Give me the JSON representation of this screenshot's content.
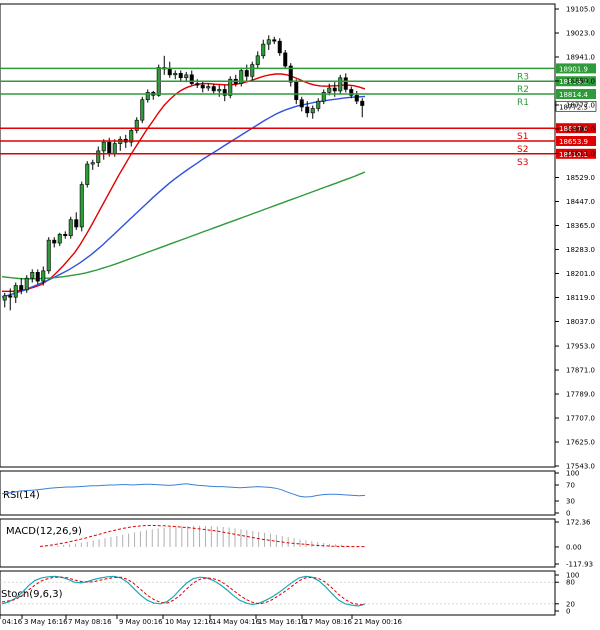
{
  "chart_data": {
    "type": "candlestick",
    "price_axis": {
      "ticks": [
        "19105.0",
        "19023.0",
        "18941.0",
        "18859.0",
        "18777.0",
        "18695.0",
        "18611.0",
        "18529.0",
        "18447.0",
        "18365.0",
        "18283.0",
        "18201.0",
        "18119.0",
        "18037.0",
        "17953.0",
        "17871.0",
        "17789.0",
        "17707.0",
        "17625.0",
        "17543.0"
      ],
      "ylim": [
        17543.0,
        19105.0
      ]
    },
    "time_axis": {
      "ticks": [
        "04:16",
        "3 May 16:16",
        "7 May 08:16",
        "9 May 00:16",
        "10 May 12:16",
        "14 May 04:16",
        "15 May 16:16",
        "17 May 08:16",
        "21 May 00:16"
      ]
    },
    "candles": [
      {
        "o": 18110,
        "h": 18135,
        "l": 18085,
        "c": 18125
      },
      {
        "o": 18125,
        "h": 18150,
        "l": 18075,
        "c": 18120
      },
      {
        "o": 18120,
        "h": 18170,
        "l": 18100,
        "c": 18160
      },
      {
        "o": 18160,
        "h": 18185,
        "l": 18130,
        "c": 18145
      },
      {
        "o": 18145,
        "h": 18195,
        "l": 18135,
        "c": 18185
      },
      {
        "o": 18185,
        "h": 18215,
        "l": 18170,
        "c": 18205
      },
      {
        "o": 18205,
        "h": 18215,
        "l": 18165,
        "c": 18175
      },
      {
        "o": 18175,
        "h": 18225,
        "l": 18160,
        "c": 18210
      },
      {
        "o": 18210,
        "h": 18325,
        "l": 18200,
        "c": 18315
      },
      {
        "o": 18315,
        "h": 18325,
        "l": 18290,
        "c": 18305
      },
      {
        "o": 18305,
        "h": 18340,
        "l": 18295,
        "c": 18335
      },
      {
        "o": 18335,
        "h": 18345,
        "l": 18320,
        "c": 18330
      },
      {
        "o": 18330,
        "h": 18395,
        "l": 18320,
        "c": 18385
      },
      {
        "o": 18385,
        "h": 18410,
        "l": 18350,
        "c": 18360
      },
      {
        "o": 18360,
        "h": 18515,
        "l": 18345,
        "c": 18505
      },
      {
        "o": 18505,
        "h": 18585,
        "l": 18495,
        "c": 18575
      },
      {
        "o": 18575,
        "h": 18590,
        "l": 18555,
        "c": 18580
      },
      {
        "o": 18580,
        "h": 18635,
        "l": 18565,
        "c": 18620
      },
      {
        "o": 18620,
        "h": 18660,
        "l": 18590,
        "c": 18650
      },
      {
        "o": 18650,
        "h": 18665,
        "l": 18600,
        "c": 18610
      },
      {
        "o": 18610,
        "h": 18660,
        "l": 18600,
        "c": 18645
      },
      {
        "o": 18645,
        "h": 18670,
        "l": 18620,
        "c": 18660
      },
      {
        "o": 18660,
        "h": 18675,
        "l": 18630,
        "c": 18650
      },
      {
        "o": 18650,
        "h": 18700,
        "l": 18635,
        "c": 18690
      },
      {
        "o": 18690,
        "h": 18735,
        "l": 18680,
        "c": 18725
      },
      {
        "o": 18725,
        "h": 18805,
        "l": 18715,
        "c": 18795
      },
      {
        "o": 18795,
        "h": 18830,
        "l": 18785,
        "c": 18820
      },
      {
        "o": 18820,
        "h": 18825,
        "l": 18795,
        "c": 18810
      },
      {
        "o": 18810,
        "h": 18915,
        "l": 18805,
        "c": 18905
      },
      {
        "o": 18905,
        "h": 18945,
        "l": 18880,
        "c": 18900
      },
      {
        "o": 18900,
        "h": 18925,
        "l": 18870,
        "c": 18880
      },
      {
        "o": 18880,
        "h": 18895,
        "l": 18865,
        "c": 18885
      },
      {
        "o": 18885,
        "h": 18895,
        "l": 18860,
        "c": 18870
      },
      {
        "o": 18870,
        "h": 18890,
        "l": 18855,
        "c": 18880
      },
      {
        "o": 18880,
        "h": 18895,
        "l": 18845,
        "c": 18850
      },
      {
        "o": 18850,
        "h": 18865,
        "l": 18835,
        "c": 18845
      },
      {
        "o": 18845,
        "h": 18860,
        "l": 18820,
        "c": 18835
      },
      {
        "o": 18835,
        "h": 18850,
        "l": 18825,
        "c": 18840
      },
      {
        "o": 18840,
        "h": 18850,
        "l": 18815,
        "c": 18825
      },
      {
        "o": 18825,
        "h": 18845,
        "l": 18805,
        "c": 18830
      },
      {
        "o": 18830,
        "h": 18845,
        "l": 18790,
        "c": 18810
      },
      {
        "o": 18810,
        "h": 18875,
        "l": 18800,
        "c": 18865
      },
      {
        "o": 18865,
        "h": 18880,
        "l": 18840,
        "c": 18850
      },
      {
        "o": 18850,
        "h": 18905,
        "l": 18840,
        "c": 18895
      },
      {
        "o": 18895,
        "h": 18915,
        "l": 18860,
        "c": 18875
      },
      {
        "o": 18875,
        "h": 18925,
        "l": 18860,
        "c": 18915
      },
      {
        "o": 18915,
        "h": 18960,
        "l": 18900,
        "c": 18945
      },
      {
        "o": 18945,
        "h": 19000,
        "l": 18935,
        "c": 18985
      },
      {
        "o": 18985,
        "h": 19015,
        "l": 18965,
        "c": 19000
      },
      {
        "o": 19000,
        "h": 19010,
        "l": 18985,
        "c": 18995
      },
      {
        "o": 18995,
        "h": 19005,
        "l": 18945,
        "c": 18955
      },
      {
        "o": 18955,
        "h": 18965,
        "l": 18900,
        "c": 18910
      },
      {
        "o": 18910,
        "h": 18920,
        "l": 18840,
        "c": 18855
      },
      {
        "o": 18855,
        "h": 18865,
        "l": 18780,
        "c": 18795
      },
      {
        "o": 18795,
        "h": 18805,
        "l": 18755,
        "c": 18770
      },
      {
        "o": 18770,
        "h": 18790,
        "l": 18735,
        "c": 18750
      },
      {
        "o": 18750,
        "h": 18775,
        "l": 18730,
        "c": 18765
      },
      {
        "o": 18765,
        "h": 18800,
        "l": 18755,
        "c": 18790
      },
      {
        "o": 18790,
        "h": 18830,
        "l": 18780,
        "c": 18820
      },
      {
        "o": 18820,
        "h": 18850,
        "l": 18810,
        "c": 18835
      },
      {
        "o": 18835,
        "h": 18855,
        "l": 18805,
        "c": 18825
      },
      {
        "o": 18825,
        "h": 18880,
        "l": 18815,
        "c": 18870
      },
      {
        "o": 18870,
        "h": 18885,
        "l": 18820,
        "c": 18830
      },
      {
        "o": 18830,
        "h": 18840,
        "l": 18800,
        "c": 18810
      },
      {
        "o": 18810,
        "h": 18825,
        "l": 18780,
        "c": 18790
      },
      {
        "o": 18790,
        "h": 18800,
        "l": 18735,
        "c": 18775
      }
    ],
    "moving_averages": [
      {
        "color": "#e00000",
        "values": [
          18140,
          18140,
          18140,
          18142,
          18145,
          18150,
          18156,
          18163,
          18175,
          18190,
          18208,
          18228,
          18250,
          18272,
          18300,
          18332,
          18365,
          18400,
          18435,
          18470,
          18505,
          18540,
          18572,
          18605,
          18635,
          18665,
          18695,
          18722,
          18750,
          18775,
          18795,
          18812,
          18826,
          18836,
          18843,
          18848,
          18850,
          18850,
          18848,
          18847,
          18846,
          18846,
          18848,
          18852,
          18857,
          18863,
          18870,
          18876,
          18880,
          18883,
          18883,
          18880,
          18874,
          18866,
          18858,
          18850,
          18845,
          18842,
          18841,
          18842,
          18843,
          18845,
          18845,
          18843,
          18838,
          18832
        ]
      },
      {
        "color": "#3050e0",
        "values": [
          18120,
          18126,
          18132,
          18138,
          18144,
          18152,
          18160,
          18168,
          18176,
          18185,
          18194,
          18204,
          18214,
          18226,
          18238,
          18252,
          18266,
          18282,
          18298,
          18316,
          18334,
          18352,
          18370,
          18388,
          18406,
          18424,
          18442,
          18460,
          18477,
          18494,
          18510,
          18525,
          18539,
          18553,
          18566,
          18579,
          18592,
          18604,
          18616,
          18628,
          18640,
          18652,
          18664,
          18676,
          18688,
          18700,
          18712,
          18724,
          18735,
          18745,
          18754,
          18762,
          18768,
          18774,
          18778,
          18782,
          18786,
          18789,
          18792,
          18795,
          18797,
          18800,
          18802,
          18804,
          18805,
          18806
        ]
      },
      {
        "color": "#2e9a3a",
        "values": [
          18190,
          18188,
          18186,
          18184,
          18183,
          18183,
          18183,
          18184,
          18185,
          18186,
          18188,
          18190,
          18193,
          18196,
          18199,
          18203,
          18208,
          18213,
          18219,
          18225,
          18231,
          18238,
          18245,
          18252,
          18259,
          18266,
          18273,
          18280,
          18287,
          18294,
          18301,
          18308,
          18315,
          18322,
          18329,
          18336,
          18343,
          18350,
          18357,
          18364,
          18371,
          18378,
          18385,
          18392,
          18399,
          18406,
          18413,
          18420,
          18427,
          18434,
          18441,
          18448,
          18455,
          18462,
          18469,
          18476,
          18483,
          18490,
          18497,
          18504,
          18511,
          18518,
          18525,
          18532,
          18540,
          18548
        ]
      }
    ],
    "levels": [
      {
        "name": "R3",
        "value": 18901.9,
        "label": "18901.9",
        "color": "#2e9a3a"
      },
      {
        "name": "R2",
        "value": 18858.1,
        "label": "18858.1",
        "color": "#2e9a3a"
      },
      {
        "name": "R1",
        "value": 18814.4,
        "label": "18814.4",
        "color": "#2e9a3a"
      },
      {
        "name": "S1",
        "value": 18697.6,
        "label": "18697.6",
        "color": "#e00000"
      },
      {
        "name": "S2",
        "value": 18653.9,
        "label": "18653.9",
        "color": "#e00000"
      },
      {
        "name": "S3",
        "value": 18610.1,
        "label": "18610.1",
        "color": "#e00000"
      }
    ],
    "current_price": {
      "value": 18772.5,
      "label": "18772.5"
    },
    "rsi": {
      "title": "RSI(14)",
      "ticks": [
        "100",
        "70",
        "30",
        "0"
      ],
      "ylim": [
        0,
        100
      ],
      "values": [
        48,
        50,
        52,
        55,
        56,
        57,
        58,
        60,
        62,
        63,
        64,
        65,
        65,
        66,
        67,
        68,
        68,
        69,
        70,
        70,
        71,
        71,
        70,
        71,
        72,
        72,
        71,
        70,
        69,
        70,
        72,
        73,
        71,
        69,
        68,
        67,
        66,
        66,
        65,
        64,
        63,
        64,
        65,
        66,
        65,
        64,
        62,
        58,
        52,
        47,
        42,
        40,
        41,
        44,
        46,
        47,
        47,
        46,
        45,
        44,
        43,
        44
      ]
    },
    "macd": {
      "title": "MACD(12,26,9)",
      "ticks": [
        "172.36",
        "0.00",
        "-117.93"
      ],
      "ylim": [
        -117.93,
        172.36
      ],
      "histogram": [
        2,
        4,
        6,
        10,
        14,
        18,
        24,
        30,
        36,
        44,
        52,
        60,
        68,
        76,
        84,
        92,
        100,
        108,
        116,
        122,
        128,
        132,
        136,
        140,
        142,
        144,
        145,
        146,
        145,
        144,
        142,
        138,
        134,
        128,
        122,
        116,
        110,
        104,
        98,
        92,
        84,
        76,
        68,
        60,
        52,
        46,
        40,
        34,
        28,
        22,
        18,
        14,
        10,
        6,
        4,
        2
      ],
      "signal": [
        4,
        8,
        14,
        22,
        30,
        40,
        50,
        60,
        72,
        84,
        96,
        108,
        118,
        128,
        136,
        142,
        146,
        148,
        148,
        147,
        145,
        142,
        138,
        134,
        130,
        125,
        120,
        114,
        108,
        100,
        92,
        84,
        76,
        68,
        60,
        52,
        46,
        40,
        34,
        28,
        24,
        20,
        16,
        12,
        9,
        7,
        5,
        4,
        3,
        2,
        2,
        2
      ]
    },
    "stoch": {
      "title": "Stoch(9,6,3)",
      "ticks": [
        "100",
        "80",
        "20",
        "0"
      ],
      "ylim": [
        0,
        100
      ],
      "k": [
        20,
        25,
        35,
        50,
        70,
        85,
        92,
        95,
        96,
        94,
        88,
        80,
        78,
        82,
        88,
        92,
        95,
        96,
        92,
        80,
        62,
        44,
        30,
        22,
        20,
        26,
        40,
        60,
        78,
        90,
        94,
        92,
        85,
        74,
        60,
        44,
        30,
        22,
        18,
        22,
        30,
        40,
        52,
        66,
        80,
        92,
        96,
        94,
        84,
        68,
        48,
        30,
        20,
        16,
        14,
        20
      ],
      "d": [
        25,
        28,
        32,
        42,
        58,
        72,
        84,
        90,
        94,
        94,
        92,
        86,
        82,
        80,
        82,
        86,
        90,
        93,
        94,
        88,
        76,
        60,
        44,
        32,
        24,
        22,
        30,
        44,
        62,
        78,
        88,
        92,
        90,
        84,
        72,
        58,
        44,
        32,
        24,
        20,
        24,
        32,
        44,
        56,
        70,
        84,
        92,
        94,
        90,
        80,
        64,
        46,
        32,
        22,
        18,
        16
      ]
    }
  }
}
